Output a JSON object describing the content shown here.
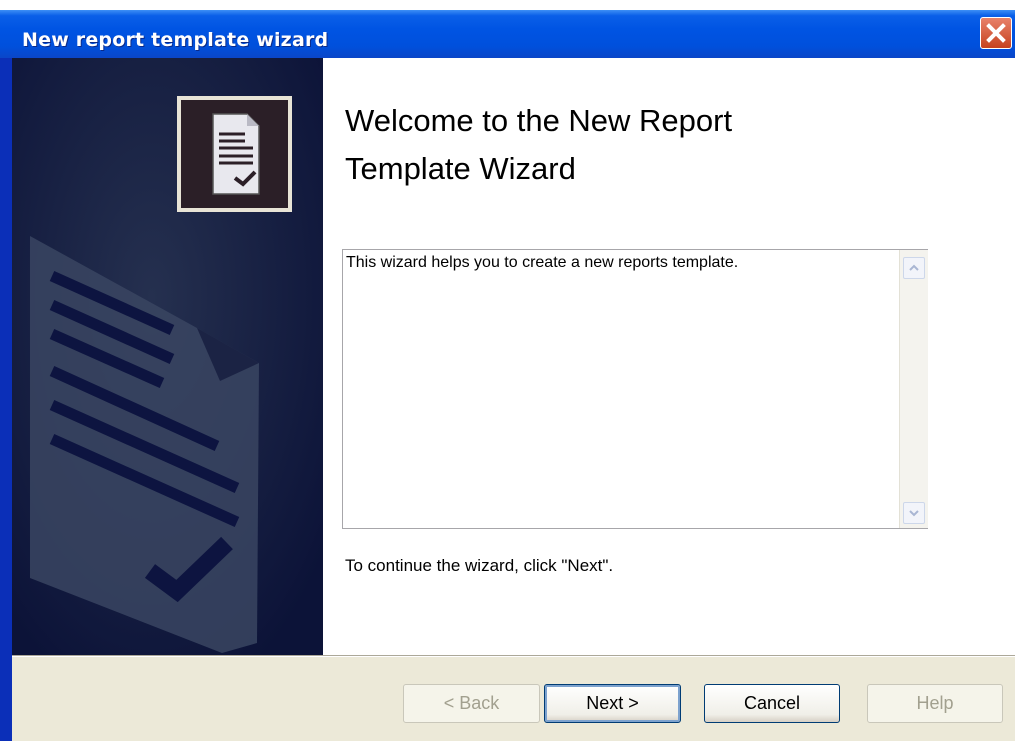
{
  "window": {
    "title": "New report template wizard",
    "close_label": "✕"
  },
  "icons": {
    "header": "report-document-check-icon",
    "background": "report-document-watermark"
  },
  "content": {
    "heading": "Welcome to the New Report Template Wizard",
    "description": "This wizard helps you to create a new reports template.",
    "continue_text": "To continue the wizard, click \"Next\"."
  },
  "buttons": {
    "back": "< Back",
    "next": "Next >",
    "cancel": "Cancel",
    "help": "Help"
  },
  "colors": {
    "titlebar": "#0054e3",
    "side_panel": "#0d1440",
    "footer": "#ece9d8",
    "close": "#d3532f"
  }
}
